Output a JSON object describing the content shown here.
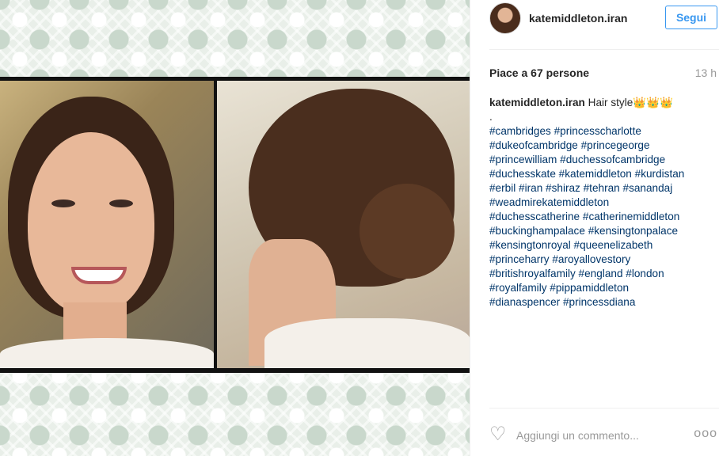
{
  "post": {
    "username": "katemiddleton.iran",
    "follow_label": "Segui",
    "likes_text": "Piace a 67 persone",
    "time_ago": "13 h",
    "caption_user": "katemiddleton.iran",
    "caption_text": "Hair style👑👑👑",
    "caption_dot": ".",
    "hashtag_lines": [
      "#cambridges #princesscharlotte",
      "#dukeofcambridge #princegeorge",
      "#princewilliam #duchessofcambridge",
      "#duchesskate #katemiddleton #kurdistan",
      "#erbil #iran #shiraz #tehran #sanandaj",
      "#weadmirekatemiddleton",
      "#duchesscatherine #catherinemiddleton",
      "#buckinghampalace #kensingtonpalace",
      "#kensingtonroyal #queenelizabeth",
      "#princeharry #aroyallovestory",
      "#britishroyalfamily #england #london",
      "#royalfamily #pippamiddleton",
      "#dianaspencer #princessdiana"
    ]
  },
  "comment": {
    "placeholder": "Aggiungi un commento...",
    "more_label": "ooo"
  },
  "icons": {
    "heart": "heart-outline-icon",
    "more": "more-options-icon"
  },
  "colors": {
    "accent": "#3897f0",
    "hashtag": "#003569"
  }
}
